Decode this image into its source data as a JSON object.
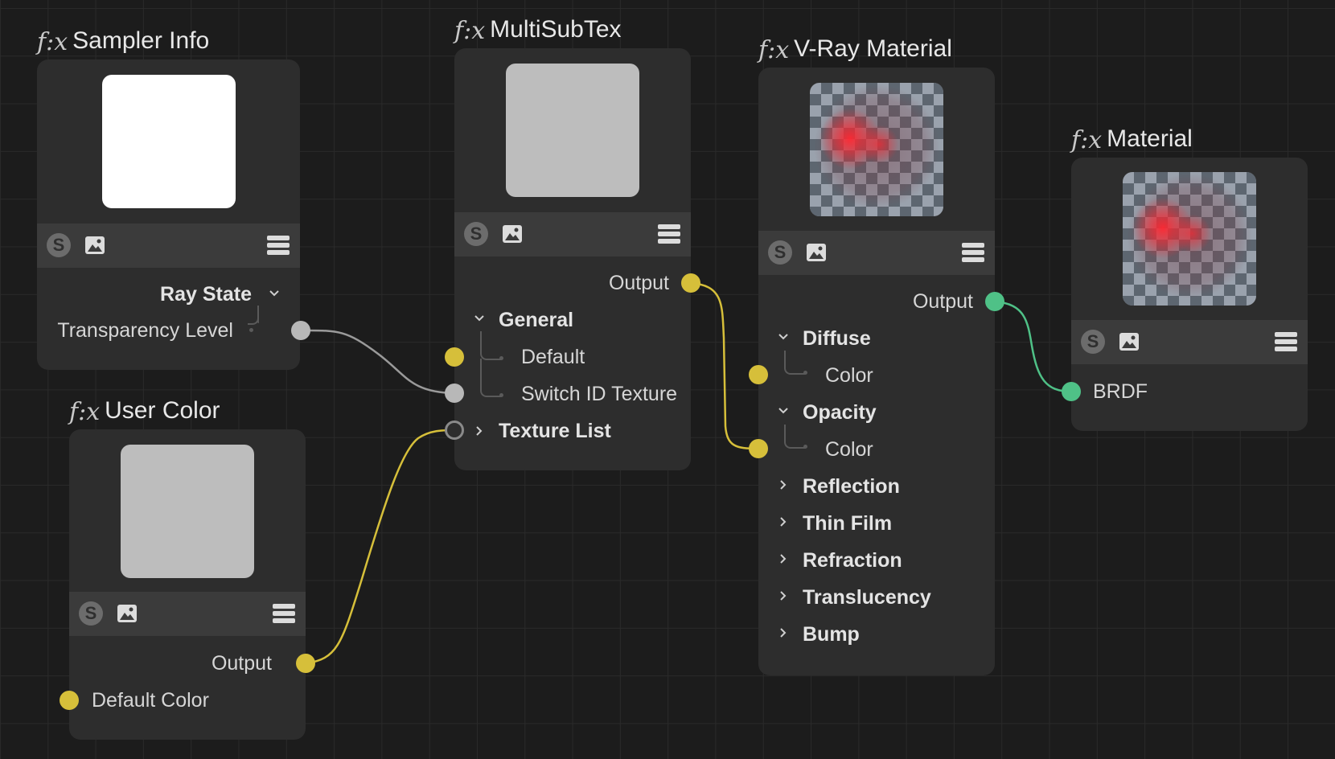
{
  "nodes": {
    "sampler_info": {
      "title": "Sampler Info",
      "fx": "f:x",
      "ray_state": "Ray State",
      "transparency_level": "Transparency Level"
    },
    "user_color": {
      "title": "User Color",
      "fx": "f:x",
      "output": "Output",
      "default_color": "Default Color"
    },
    "multisubtex": {
      "title": "MultiSubTex",
      "fx": "f:x",
      "output": "Output",
      "general": "General",
      "default": "Default",
      "switch_id": "Switch ID Texture",
      "texture_list": "Texture List"
    },
    "vray_material": {
      "title": "V-Ray Material",
      "fx": "f:x",
      "output": "Output",
      "diffuse": "Diffuse",
      "diffuse_color": "Color",
      "opacity": "Opacity",
      "opacity_color": "Color",
      "reflection": "Reflection",
      "thin_film": "Thin Film",
      "refraction": "Refraction",
      "translucency": "Translucency",
      "bump": "Bump"
    },
    "material": {
      "title": "Material",
      "fx": "f:x",
      "brdf": "BRDF"
    }
  },
  "toolbar": {
    "s_label": "S"
  },
  "colors": {
    "background": "#1c1c1c",
    "node": "#2d2d2d",
    "toolbar": "#3b3b3b",
    "port_yellow": "#d6bf3a",
    "port_green": "#4fc187",
    "port_grey": "#b8b8b8"
  }
}
